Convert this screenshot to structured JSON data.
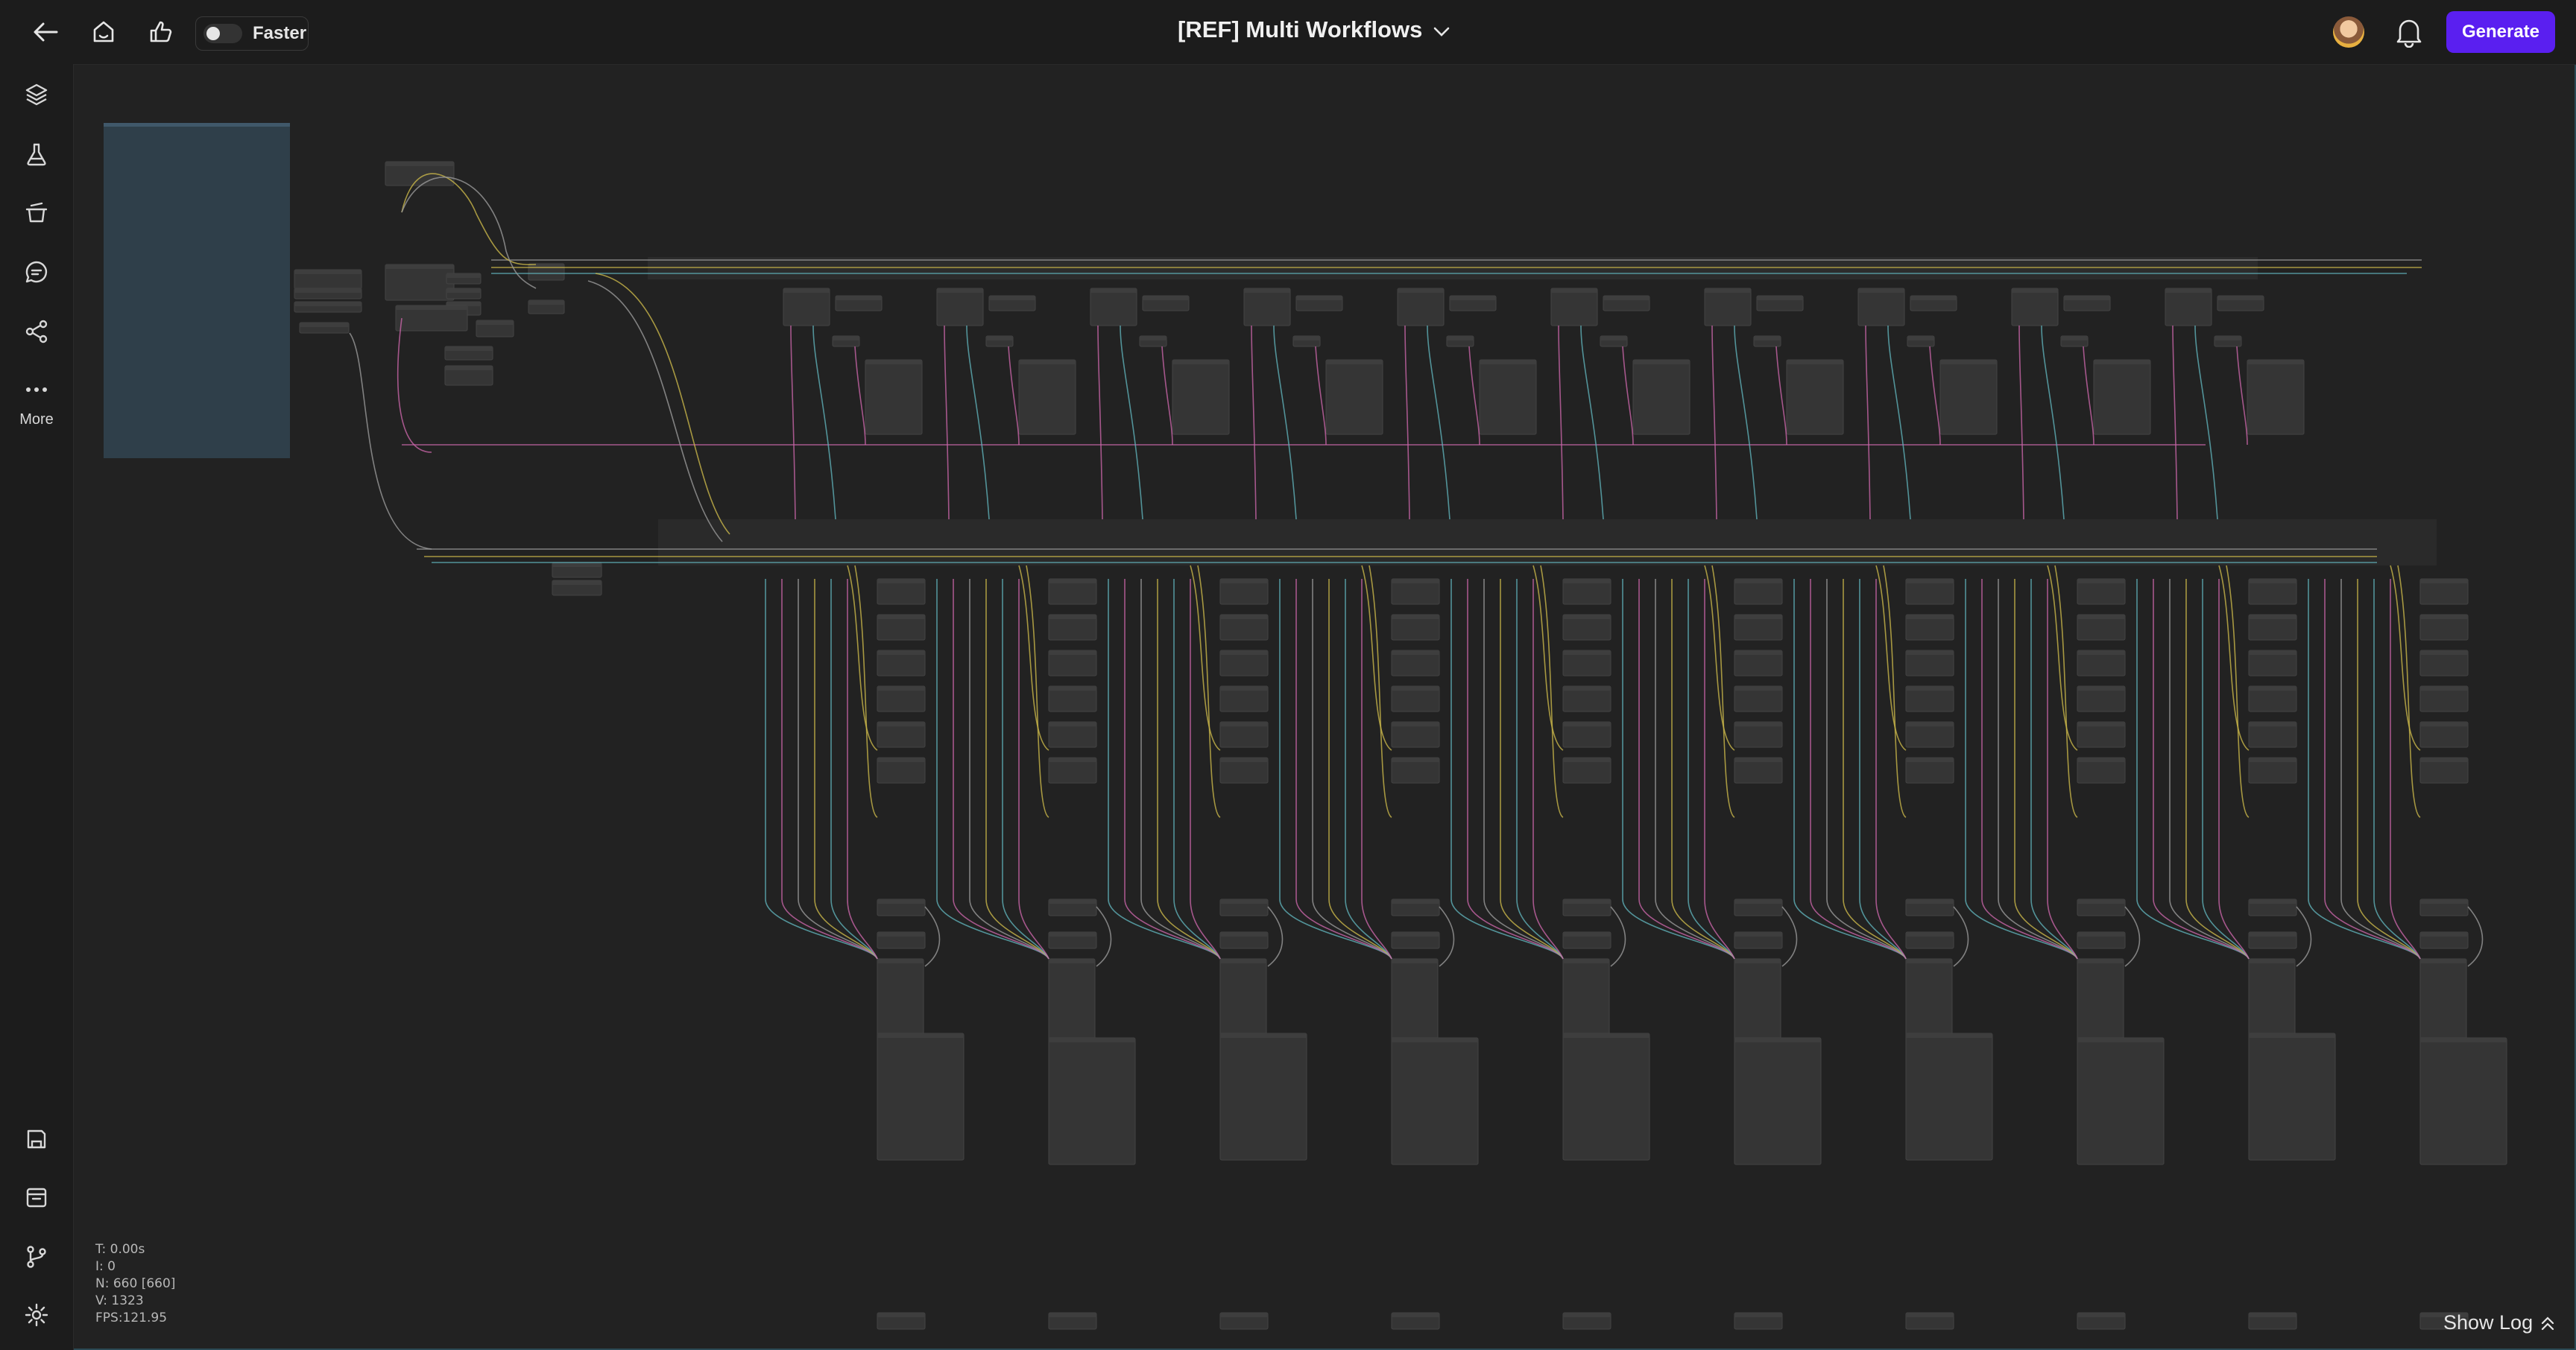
{
  "header": {
    "toggle_label": "Faster",
    "title": "[REF] Multi Workflows",
    "generate_label": "Generate"
  },
  "sidebar": {
    "more_label": "More"
  },
  "stats": {
    "t": "T: 0.00s",
    "i": "I: 0",
    "n": "N: 660 [660]",
    "v": "V: 1323",
    "fps": "FPS:121.95"
  },
  "footer": {
    "show_log_label": "Show Log"
  },
  "colors": {
    "accent": "#5a1ff0",
    "group_box": "#2f3f4a",
    "node": "#353535",
    "wire_yellow": "#c9b64a",
    "wire_pink": "#c865a8",
    "wire_teal": "#5fb0b8",
    "wire_gray": "#9a9a9a"
  }
}
